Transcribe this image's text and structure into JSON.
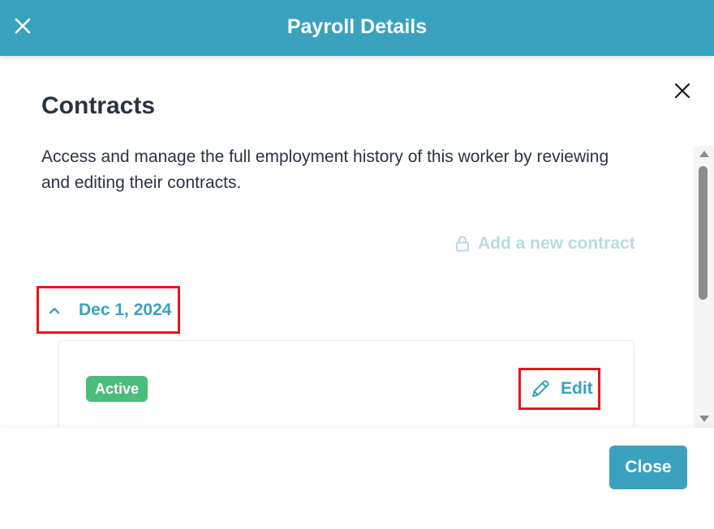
{
  "header": {
    "title": "Payroll Details",
    "close_icon": "close-icon"
  },
  "panel": {
    "close_icon": "close-icon"
  },
  "section": {
    "title": "Contracts",
    "description": "Access and manage the full employment history of this worker by reviewing and editing their contracts."
  },
  "actions": {
    "add_contract_label": "Add a new contract",
    "add_contract_icon": "lock-icon",
    "add_contract_disabled": true
  },
  "contracts": [
    {
      "date": "Dec 1, 2024",
      "expanded": true,
      "toggle_icon": "chevron-up-icon",
      "status": "Active",
      "edit_label": "Edit",
      "edit_icon": "pencil-icon"
    }
  ],
  "footer": {
    "close_label": "Close"
  },
  "colors": {
    "brand": "#3aa2bf",
    "heading": "#2a3342",
    "disabled_link": "#b5dbe6",
    "active_badge": "#4bbd7a",
    "highlight_border": "#e8141c"
  }
}
